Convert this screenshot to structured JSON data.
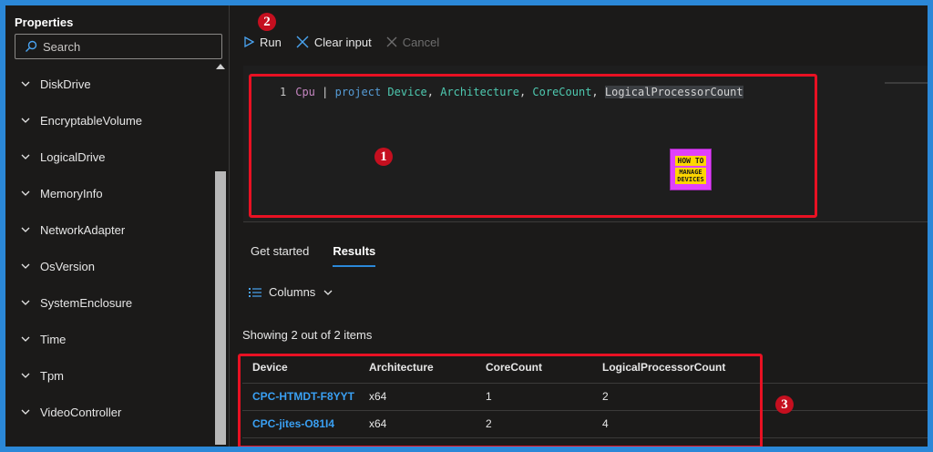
{
  "sidebar": {
    "title": "Properties",
    "search_placeholder": "Search",
    "items": [
      {
        "label": "DiskDrive"
      },
      {
        "label": "EncryptableVolume"
      },
      {
        "label": "LogicalDrive"
      },
      {
        "label": "MemoryInfo"
      },
      {
        "label": "NetworkAdapter"
      },
      {
        "label": "OsVersion"
      },
      {
        "label": "SystemEnclosure"
      },
      {
        "label": "Time"
      },
      {
        "label": "Tpm"
      },
      {
        "label": "VideoController"
      }
    ]
  },
  "toolbar": {
    "run_label": "Run",
    "clear_label": "Clear input",
    "cancel_label": "Cancel"
  },
  "editor": {
    "line_number": "1",
    "tokens": {
      "table": "Cpu",
      "pipe": " | ",
      "project": "project",
      "c1": "Device",
      "sep1": ", ",
      "c2": "Architecture",
      "sep2": ", ",
      "c3": "CoreCount",
      "sep3": ", ",
      "c4": "LogicalProcessorCount"
    }
  },
  "logo": {
    "top": "HOW TO",
    "bottom_1": "MANAGE",
    "bottom_2": "DEVICES"
  },
  "annotations": {
    "one": "1",
    "two": "2",
    "three": "3"
  },
  "tabs": [
    {
      "label": "Get started"
    },
    {
      "label": "Results"
    }
  ],
  "columns_label": "Columns",
  "showing_text": "Showing 2 out of 2 items",
  "table": {
    "headers": [
      "Device",
      "Architecture",
      "CoreCount",
      "LogicalProcessorCount"
    ],
    "rows": [
      [
        "CPC-HTMDT-F8YYT",
        "x64",
        "1",
        "2"
      ],
      [
        "CPC-jites-O81I4",
        "x64",
        "2",
        "4"
      ]
    ]
  },
  "colors": {
    "accent": "#2b88d8",
    "annotation_red": "#e81123",
    "link": "#3aa0f3"
  }
}
